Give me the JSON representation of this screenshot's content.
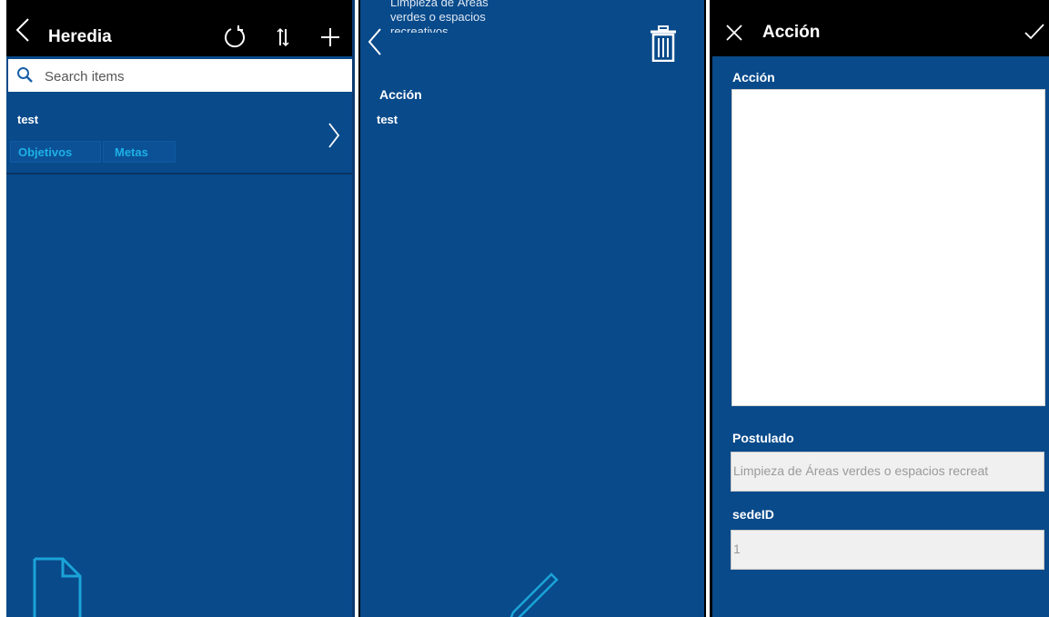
{
  "list_panel": {
    "title": "Heredia",
    "search_placeholder": "Search items",
    "item": {
      "title": "test",
      "tags": [
        "Objetivos",
        "Metas"
      ]
    },
    "icons": [
      "back-icon",
      "refresh-icon",
      "sort-icon",
      "add-icon",
      "document-icon",
      "chevron-right-icon"
    ]
  },
  "detail_panel": {
    "title_lines": [
      "Limpieza de Áreas",
      "verdes o espacios",
      "recreativos"
    ],
    "field_label": "Acción",
    "field_value": "test",
    "icons": [
      "back-icon",
      "trash-icon",
      "edit-pencil-icon"
    ]
  },
  "edit_panel": {
    "title": "Acción",
    "accion_label": "Acción",
    "accion_value": "",
    "postulado_label": "Postulado",
    "postulado_value": "Limpieza de Áreas verdes o espacios recreat",
    "sedeid_label": "sedeID",
    "sedeid_value": "1",
    "icons": [
      "close-icon",
      "check-icon"
    ]
  },
  "colors": {
    "panel_bg": "#084a8a",
    "header_bg": "#000000",
    "tag_text": "#1db0e6",
    "icon_accent": "#1ba3d8"
  }
}
